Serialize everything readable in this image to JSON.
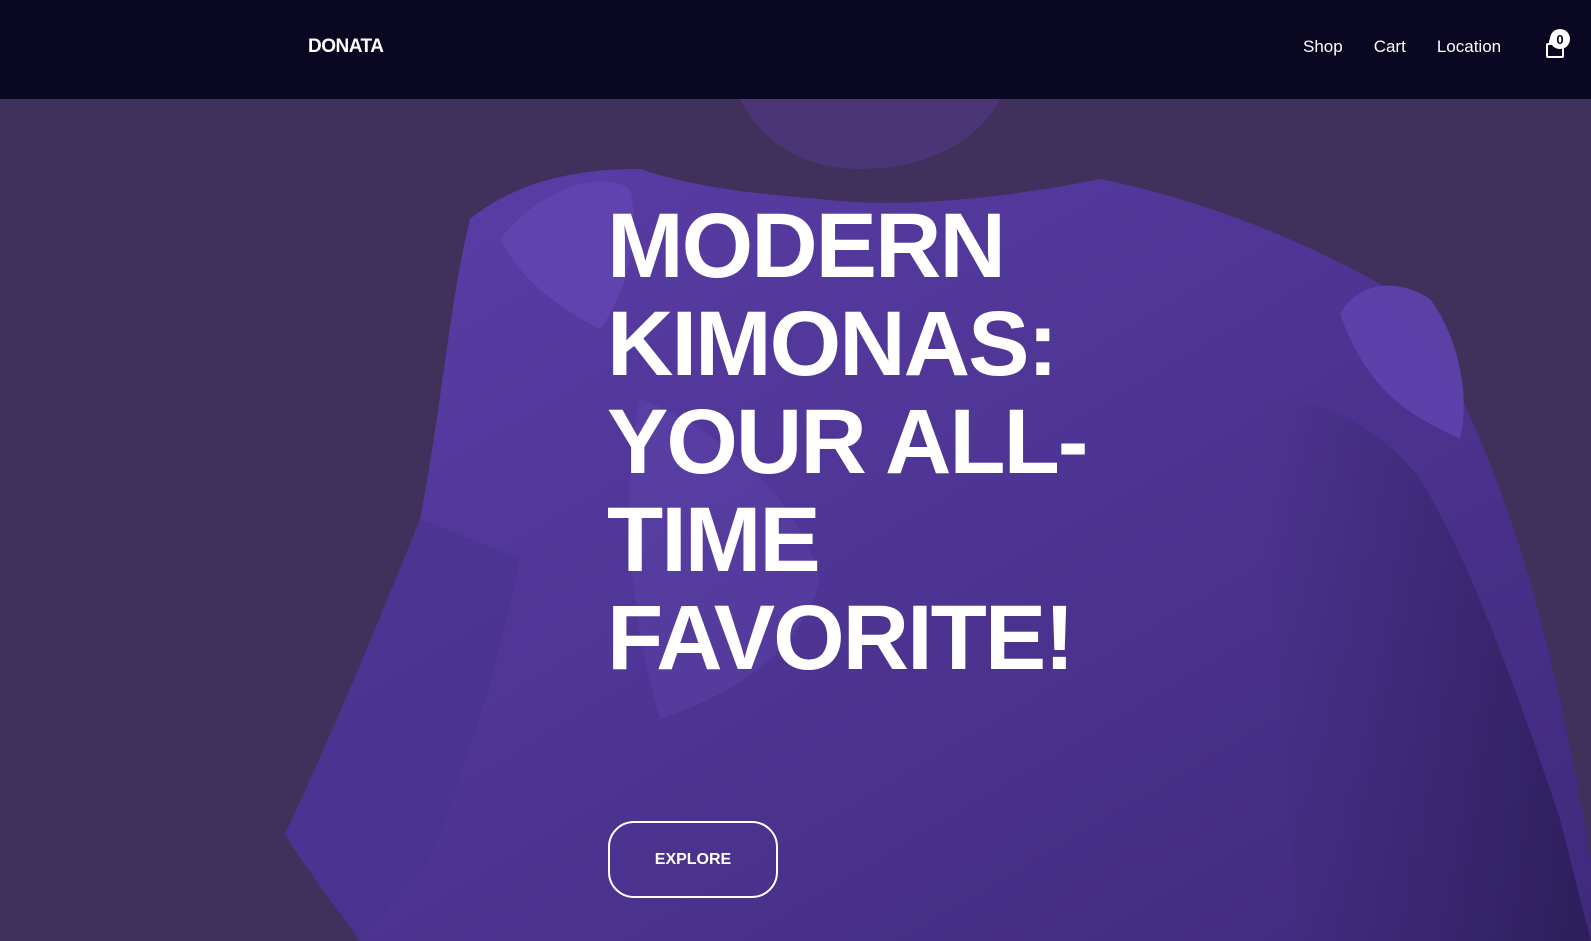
{
  "header": {
    "logo": "DONATA",
    "nav": [
      {
        "label": "Shop"
      },
      {
        "label": "Cart"
      },
      {
        "label": "Location"
      }
    ],
    "cart_icon": "shopping-bag-icon",
    "cart_count": "0"
  },
  "hero": {
    "headline": "MODERN KIMONAS: YOUR ALL-TIME FAVORITE!",
    "button_label": "EXPLORE"
  },
  "colors": {
    "header_bg": "#0a0722",
    "hero_bg": "#40305c",
    "garment": "#5a3ca0",
    "text": "#ffffff"
  }
}
